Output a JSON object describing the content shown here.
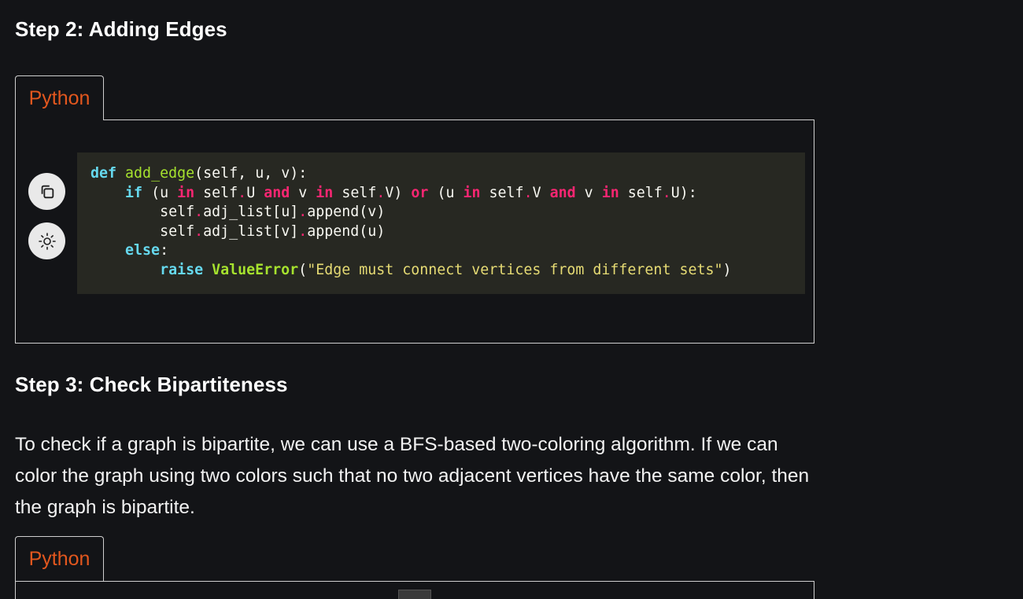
{
  "step2": {
    "heading": "Step 2: Adding Edges",
    "tab_label": "Python",
    "code": [
      "def add_edge(self, u, v):",
      "    if (u in self.U and v in self.V) or (u in self.V and v in self.U):",
      "        self.adj_list[u].append(v)",
      "        self.adj_list[v].append(u)",
      "    else:",
      "        raise ValueError(\"Edge must connect vertices from different sets\")"
    ]
  },
  "step3": {
    "heading": "Step 3: Check Bipartiteness",
    "paragraph": "To check if a graph is bipartite, we can use a BFS-based two-coloring algorithm. If we can color the graph using two colors such that no two adjacent vertices have the same color, then the graph is bipartite.",
    "tab_label": "Python"
  },
  "icons": {
    "copy": "copy-icon",
    "theme": "sun-icon"
  },
  "colors": {
    "background": "#131417",
    "code_background": "#272822",
    "tab_text": "#e2571e",
    "keyword": "#66d9ef",
    "function": "#a6e22e",
    "operator": "#f92672",
    "string": "#e6db74"
  }
}
